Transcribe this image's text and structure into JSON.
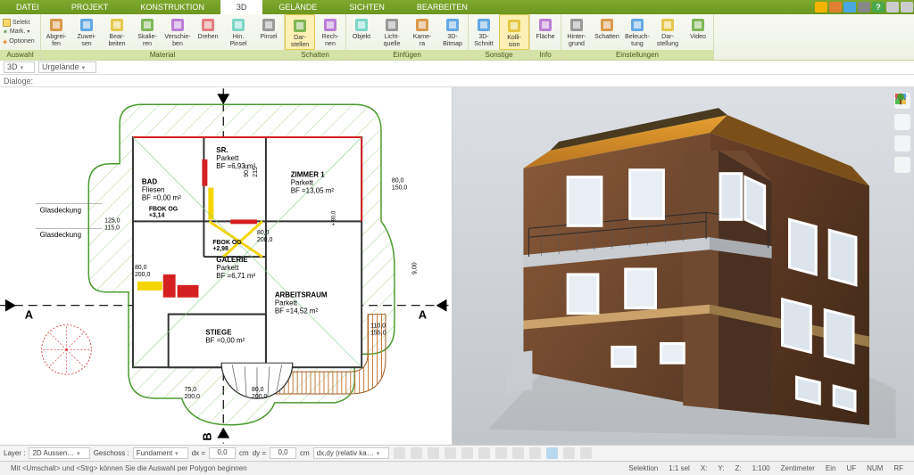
{
  "menu": {
    "tabs": [
      "DATEI",
      "PROJEKT",
      "KONSTRUKTION",
      "3D",
      "GELÄNDE",
      "SICHTEN",
      "BEARBEITEN"
    ],
    "active": 3
  },
  "options": {
    "selekt": "Selekt",
    "mark": "Mark.",
    "optionen": "Optionen"
  },
  "ribbon": {
    "auswahl_label": "Auswahl",
    "groups": [
      {
        "label": "Material",
        "items": [
          {
            "l1": "Abgrei-",
            "l2": "fen"
          },
          {
            "l1": "Zuwei-",
            "l2": "sen"
          },
          {
            "l1": "Bear-",
            "l2": "beiten"
          },
          {
            "l1": "Skalie-",
            "l2": "ren"
          },
          {
            "l1": "Verschie-",
            "l2": "ben"
          },
          {
            "l1": "Drehen",
            "l2": ""
          },
          {
            "l1": "Hin.",
            "l2": "Pinsel"
          },
          {
            "l1": "Pinsel",
            "l2": ""
          }
        ]
      },
      {
        "label": "Schatten",
        "items": [
          {
            "l1": "Dar-",
            "l2": "stellen",
            "active": true
          },
          {
            "l1": "Rech-",
            "l2": "nen"
          }
        ]
      },
      {
        "label": "Einfügen",
        "items": [
          {
            "l1": "Objekt",
            "l2": ""
          },
          {
            "l1": "Licht-",
            "l2": "quelle"
          },
          {
            "l1": "Kame-",
            "l2": "ra"
          },
          {
            "l1": "3D-",
            "l2": "Bitmap"
          }
        ]
      },
      {
        "label": "Sonstige",
        "items": [
          {
            "l1": "3D-",
            "l2": "Schnitt"
          },
          {
            "l1": "Kolli-",
            "l2": "sion",
            "active": true
          }
        ]
      },
      {
        "label": "Info",
        "items": [
          {
            "l1": "Fläche",
            "l2": ""
          }
        ]
      },
      {
        "label": "Einstellungen",
        "items": [
          {
            "l1": "Hinter-",
            "l2": "grund"
          },
          {
            "l1": "Schatten",
            "l2": ""
          },
          {
            "l1": "Beleuch-",
            "l2": "tung"
          },
          {
            "l1": "Dar-",
            "l2": "stellung"
          },
          {
            "l1": "Video",
            "l2": ""
          }
        ]
      }
    ]
  },
  "subbar": {
    "view": "3D",
    "terrain": "Urgelände"
  },
  "dialoge": "Dialoge:",
  "plan": {
    "section_a": "A",
    "section_b": "B",
    "rooms": {
      "bad": {
        "name": "BAD",
        "floor": "Fliesen",
        "area": "BF =0,00 m²",
        "fbok": "FBOK OG",
        "fbok_v": "+3,14"
      },
      "sr": {
        "name": "SR.",
        "floor": "Parkett",
        "area": "BF =6,93 m²"
      },
      "zimmer1": {
        "name": "ZIMMER 1",
        "floor": "Parkett",
        "area": "BF =13,05 m²"
      },
      "galerie": {
        "name": "GALERIE",
        "floor": "Parkett",
        "area": "BF =6,71 m²",
        "fbok": "FBOK OG",
        "fbok_v": "+2,98"
      },
      "arbeitsraum": {
        "name": "ARBEITSRAUM",
        "floor": "Parkett",
        "area": "BF =14,52 m²"
      },
      "stiege": {
        "name": "STIEGE",
        "area": "BF =0,00 m²"
      }
    },
    "glasdeckung": "Glasdeckung",
    "dims": {
      "d125": "125,0",
      "d115": "115,0",
      "d80": "80,0",
      "d200": "200,0",
      "d150": "150,0",
      "d75": "75,0",
      "d90": "90,0",
      "d215": "215",
      "d110": "110,0",
      "d155": "155,0",
      "d900": "9,00"
    }
  },
  "bottom": {
    "layer_lbl": "Layer :",
    "layer_val": "2D Aussen…",
    "geschoss_lbl": "Geschoss :",
    "geschoss_val": "Fundament",
    "dx": "dx =",
    "dy": "dy =",
    "val0": "0,0",
    "cm": "cm",
    "mode": "dx,dy (relativ ka…"
  },
  "status": {
    "hint": "Mit <Umschalt> und <Strg> können Sie die Auswahl per Polygon beginnen",
    "selektion": "Selektion",
    "scale": "1:1 sel",
    "x": "X:",
    "y": "Y:",
    "z": "Z:",
    "ratio": "1:100",
    "unit": "Zentimeter",
    "ein": "Ein",
    "uf": "UF",
    "num": "NUM",
    "rf": "RF"
  }
}
